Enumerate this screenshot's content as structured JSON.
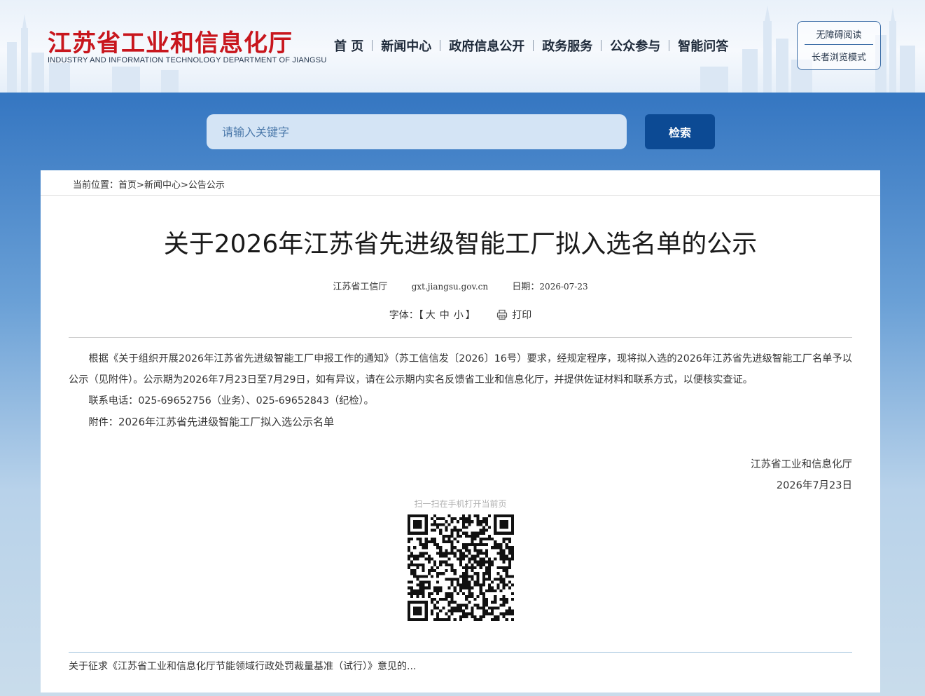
{
  "header": {
    "logo_title": "江苏省工业和信息化厅",
    "logo_subtitle": "INDUSTRY AND INFORMATION TECHNOLOGY DEPARTMENT OF JIANGSU",
    "nav": [
      "首 页",
      "新闻中心",
      "政府信息公开",
      "政务服务",
      "公众参与",
      "智能问答"
    ],
    "modes": {
      "accessible": "无障碍阅读",
      "elder": "长者浏览模式"
    }
  },
  "search": {
    "placeholder": "请输入关键字",
    "button": "检索"
  },
  "breadcrumb": {
    "prefix": "当前位置：",
    "home": "首页",
    "sep": ">",
    "news": "新闻中心",
    "current": "公告公示"
  },
  "article": {
    "title": "关于2026年江苏省先进级智能工厂拟入选名单的公示",
    "source": "江苏省工信厅",
    "site": "gxt.jiangsu.gov.cn",
    "date_label": "日期：",
    "date": "2026-07-23",
    "font_label": "字体：【",
    "font_large": "大",
    "font_medium": "中",
    "font_small": "小",
    "font_close": "】",
    "print": "打印",
    "paragraph1": "根据《关于组织开展2026年江苏省先进级智能工厂申报工作的通知》（苏工信信发〔2026〕16号）要求，经规定程序，现将拟入选的2026年江苏省先进级智能工厂名单予以公示（见附件）。公示期为2026年7月23日至7月29日，如有异议，请在公示期内实名反馈省工业和信息化厅，并提供佐证材料和联系方式，以便核实查证。",
    "paragraph2": "联系电话：025-69652756（业务）、025-69652843（纪检）。",
    "attachment_label": "附件：",
    "attachment_link": "2026年江苏省先进级智能工厂拟入选公示名单",
    "signer": "江苏省工业和信息化厅",
    "sign_date": "2026年7月23日",
    "qr_caption": "扫一扫在手机打开当前页"
  },
  "related": {
    "text": "关于征求《江苏省工业和信息化厅节能领域行政处罚裁量基准（试行）》意见的..."
  },
  "colors": {
    "brand_red": "#c8161d",
    "primary_blue": "#0c4a94",
    "search_bg": "#d4e4f5"
  }
}
